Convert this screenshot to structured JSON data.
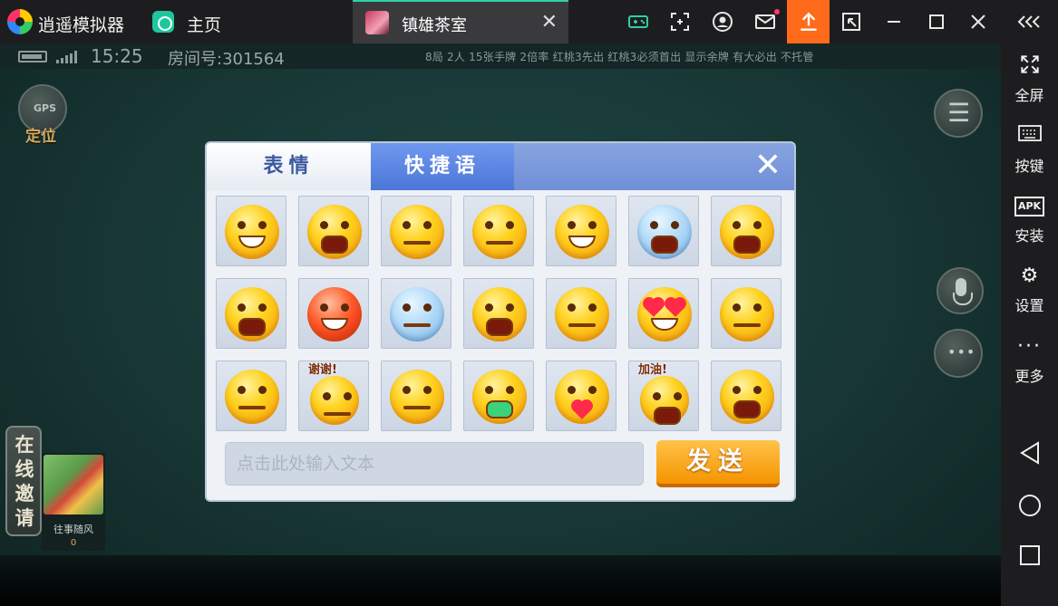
{
  "emulator": {
    "app_title": "逍遥模拟器",
    "home_tab": "主页",
    "game_tab": "镇雄茶室",
    "close_tab_glyph": "✕"
  },
  "side_panel": {
    "fullscreen": "全屏",
    "keys": "按键",
    "install": "安装",
    "settings": "设置",
    "more": "更多",
    "apk_badge": "APK"
  },
  "status": {
    "time": "15:25",
    "room": "房间号:301564",
    "rules": "8局 2人 15张手牌 2倍率 红桃3先出 红桃3必须首出 显示余牌 有大必出 不托管"
  },
  "gps": {
    "badge": "GPS",
    "label": "定位"
  },
  "invite": {
    "label": "在线邀请"
  },
  "player": {
    "name": "往事随风",
    "score": "0"
  },
  "dialog": {
    "tab_emoji": "表情",
    "tab_quick": "快捷语",
    "input_placeholder": "点击此处输入文本",
    "send": "发送",
    "caption_thanks": "谢谢!",
    "caption_cheer": "加油!"
  },
  "colors": {
    "accent_orange": "#ff6b1a",
    "tab_active_blue": "#4d77d8",
    "send_orange": "#f59400",
    "felt_green": "#173634"
  }
}
